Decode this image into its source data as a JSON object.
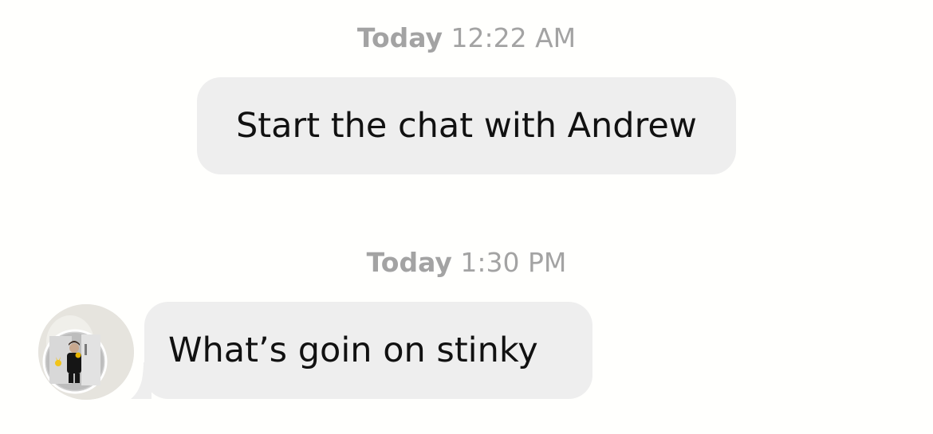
{
  "messages": [
    {
      "timestamp_day": "Today",
      "timestamp_time": "12:22 AM",
      "text": "Start the chat with Andrew"
    },
    {
      "timestamp_day": "Today",
      "timestamp_time": "1:30 PM",
      "text": "What’s goin on stinky",
      "sender_avatar": "user-avatar-photo"
    }
  ],
  "colors": {
    "bubble_background": "#eeeeee",
    "timestamp_text": "#a3a3a3",
    "message_text": "#111111",
    "page_background": "#fffffd"
  }
}
